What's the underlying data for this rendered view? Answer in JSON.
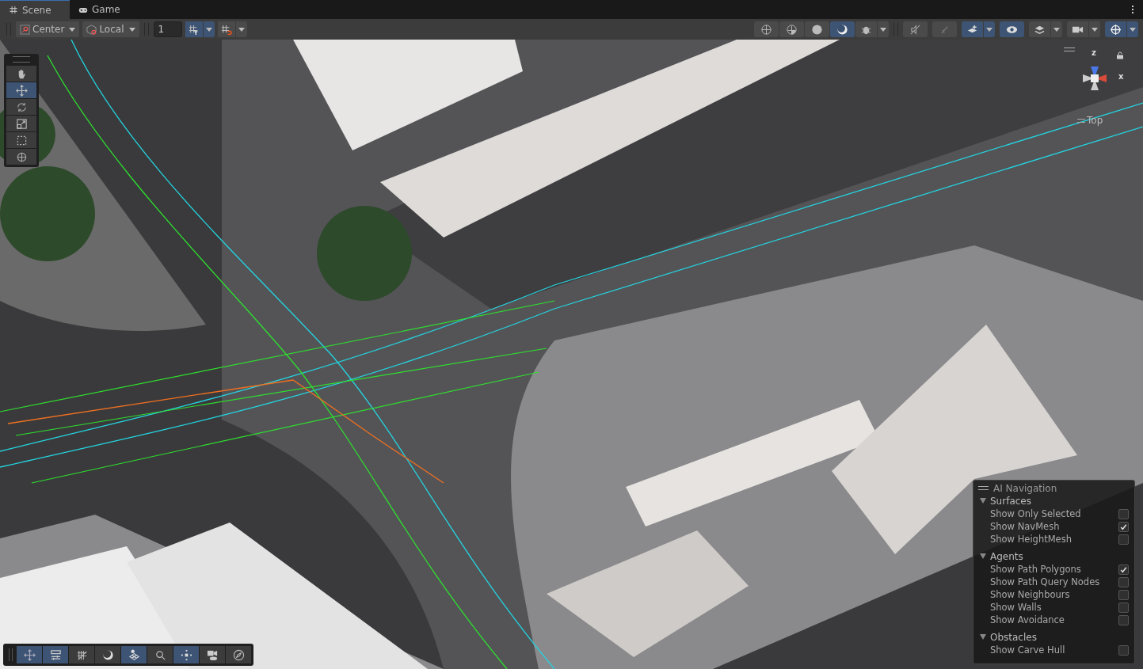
{
  "tabs": [
    {
      "label": "Scene",
      "kind": "grid",
      "selected": true
    },
    {
      "label": "Game",
      "kind": "gamepad",
      "selected": false
    }
  ],
  "toolbar": {
    "pivot": "Center",
    "space": "Local",
    "snap_value": "1",
    "snap_buttons": [
      {
        "kind": "grid-snap",
        "on": true
      },
      {
        "kind": "increment-snap",
        "on": false
      }
    ],
    "view_buttons": [
      {
        "kind": "wireframe",
        "on": false,
        "dropdown": false
      },
      {
        "kind": "shaded-wireframe",
        "on": false,
        "dropdown": false
      },
      {
        "kind": "shaded",
        "on": false,
        "dropdown": false
      },
      {
        "kind": "lit",
        "on": true,
        "dropdown": false
      },
      {
        "kind": "debug",
        "on": false,
        "dropdown": true
      }
    ],
    "scene_buttons": [
      {
        "kind": "audio",
        "on": false,
        "dropdown": false
      },
      {
        "kind": "effects",
        "on": false,
        "dropdown": false
      },
      {
        "kind": "layers-add",
        "on": true,
        "dropdown": true
      },
      {
        "kind": "visibility",
        "on": true,
        "dropdown": false
      },
      {
        "kind": "layers",
        "on": false,
        "dropdown": true
      },
      {
        "kind": "camera",
        "on": false,
        "dropdown": true
      },
      {
        "kind": "gizmos",
        "on": true,
        "dropdown": true
      }
    ]
  },
  "tools": [
    {
      "kind": "hand",
      "selected": false
    },
    {
      "kind": "move",
      "selected": true
    },
    {
      "kind": "rotate",
      "selected": false
    },
    {
      "kind": "scale",
      "selected": false
    },
    {
      "kind": "rect",
      "selected": false
    },
    {
      "kind": "transform",
      "selected": false
    }
  ],
  "orientation_gizmo": {
    "axis_up": "z",
    "axis_side": "x",
    "view": "Top"
  },
  "overlay": {
    "title": "AI Navigation",
    "sections": [
      {
        "label": "Surfaces",
        "expanded": true,
        "items": [
          {
            "label": "Show Only Selected",
            "checked": false
          },
          {
            "label": "Show NavMesh",
            "checked": true
          },
          {
            "label": "Show HeightMesh",
            "checked": false
          }
        ]
      },
      {
        "label": "Agents",
        "expanded": true,
        "items": [
          {
            "label": "Show Path Polygons",
            "checked": true
          },
          {
            "label": "Show Path Query Nodes",
            "checked": false
          },
          {
            "label": "Show Neighbours",
            "checked": false
          },
          {
            "label": "Show Walls",
            "checked": false
          },
          {
            "label": "Show Avoidance",
            "checked": false
          }
        ]
      },
      {
        "label": "Obstacles",
        "expanded": true,
        "items": [
          {
            "label": "Show Carve Hull",
            "checked": false
          }
        ]
      }
    ]
  },
  "bottom_tools": [
    {
      "kind": "move",
      "on": true
    },
    {
      "kind": "sliders",
      "on": true
    },
    {
      "kind": "grid",
      "on": false
    },
    {
      "kind": "moon",
      "on": false
    },
    {
      "kind": "navmesh",
      "on": true
    },
    {
      "kind": "search",
      "on": false
    },
    {
      "kind": "nodes",
      "on": true
    },
    {
      "kind": "camera-eye",
      "on": false
    },
    {
      "kind": "compass",
      "on": false
    }
  ]
}
